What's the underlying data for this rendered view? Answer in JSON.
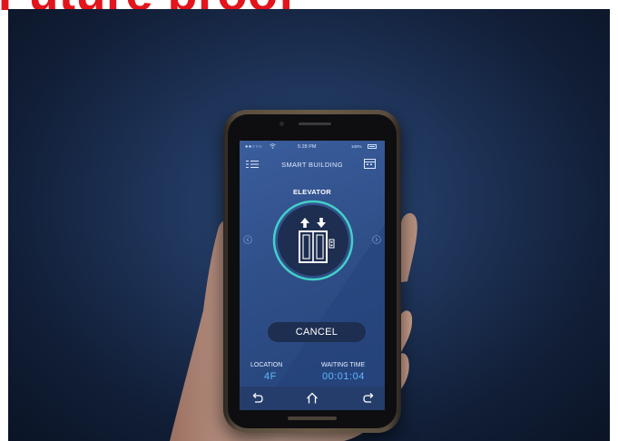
{
  "headline": "Future proof",
  "status_bar": {
    "signal": "●●○○○",
    "time": "5:28 PM",
    "battery": "100%"
  },
  "app": {
    "title": "SMART BUILDING"
  },
  "panel": {
    "title": "ELEVATOR"
  },
  "cancel_label": "CANCEL",
  "info": {
    "location_label": "LOCATION",
    "location_value": "4F",
    "waiting_label": "WAITING TIME",
    "waiting_value": "00:01:04"
  },
  "colors": {
    "headline": "#e3141b",
    "screen": "#2f4f88",
    "ring": "#43d0c8",
    "accent_value": "#5fb7ff"
  }
}
